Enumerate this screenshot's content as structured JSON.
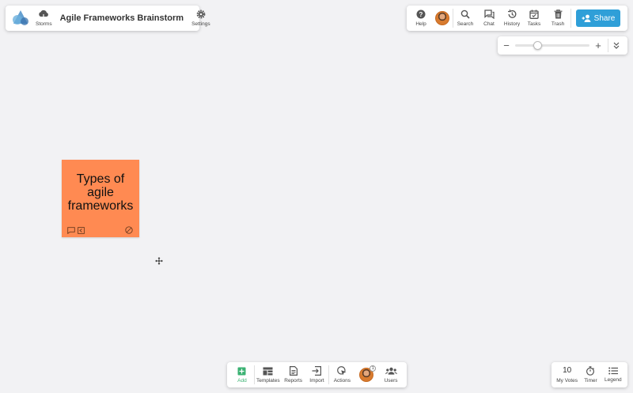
{
  "board": {
    "title": "Agile Frameworks Brainstorm"
  },
  "top_left": {
    "storms_label": "Storms",
    "settings_label": "Settings"
  },
  "top_right": {
    "help_label": "Help",
    "search_label": "Search",
    "chat_label": "Chat",
    "history_label": "History",
    "tasks_label": "Tasks",
    "trash_label": "Trash",
    "share_label": "Share"
  },
  "zoom": {
    "minus": "−",
    "plus": "+",
    "level_fraction": 0.3
  },
  "sticky": {
    "text": "Types of agile frameworks",
    "color": "#ff8a52"
  },
  "bottom_toolbar": {
    "add_label": "Add",
    "templates_label": "Templates",
    "reports_label": "Reports",
    "import_label": "Import",
    "actions_label": "Actions",
    "users_label": "Users",
    "users_badge": "1"
  },
  "bottom_right": {
    "votes_count": "10",
    "votes_label": "My Votes",
    "timer_label": "Timer",
    "legend_label": "Legend"
  },
  "colors": {
    "accent": "#2f9fd8",
    "add_green": "#3bb273"
  }
}
